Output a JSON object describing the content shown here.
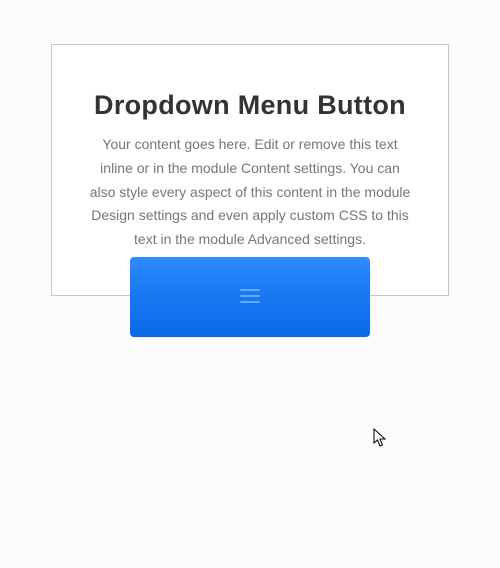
{
  "card": {
    "title": "Dropdown Menu Button",
    "description": "Your content goes here. Edit or remove this text inline or in the module Content settings. You can also style every aspect of this content in the module Design settings and even apply custom CSS to this text in the module Advanced settings."
  },
  "button": {
    "icon_name": "hamburger-icon"
  }
}
